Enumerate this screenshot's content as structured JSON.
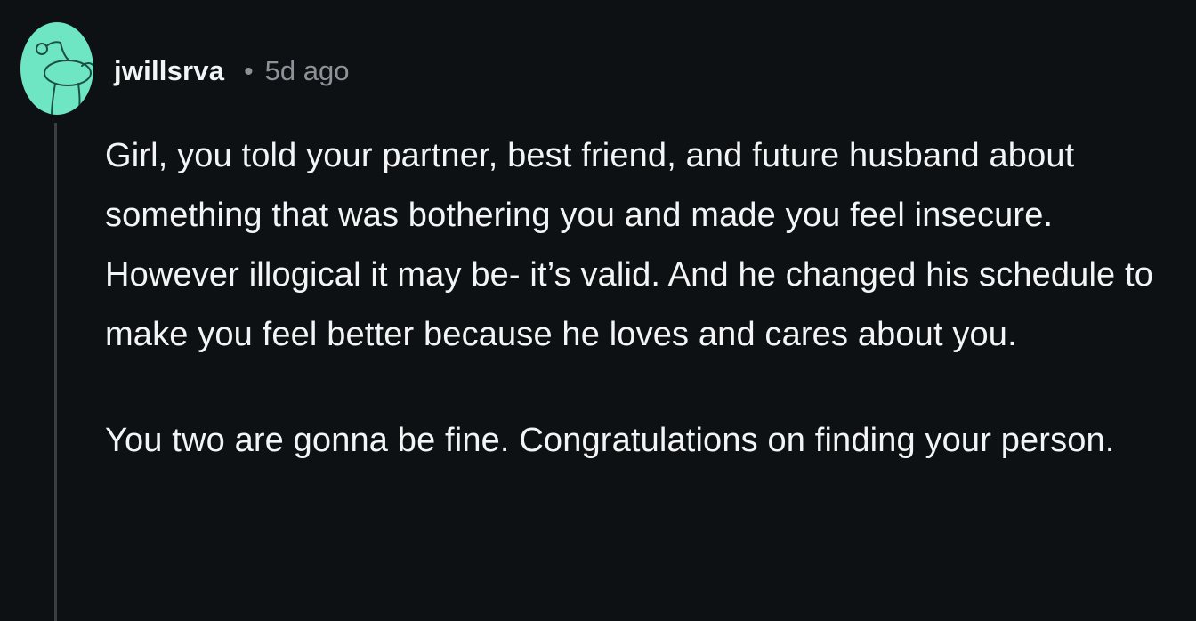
{
  "comment": {
    "author": {
      "username": "jwillsrva",
      "avatar_icon": "snoo-avatar-icon",
      "avatar_color": "#6ee6c4"
    },
    "separator": "•",
    "timestamp": "5d ago",
    "paragraphs": [
      "Girl, you told your partner, best friend, and future husband about something that was bothering you and made you feel insecure. However illogical it may be- it’s valid. And he changed his schedule to make you feel better because he loves and cares about you.",
      "You two are gonna be fine. Congratulations on finding your person."
    ]
  },
  "theme": {
    "background": "#0e1113",
    "text": "#f2f4f5",
    "muted": "#8c9396",
    "thread_line": "#3a3e41"
  }
}
